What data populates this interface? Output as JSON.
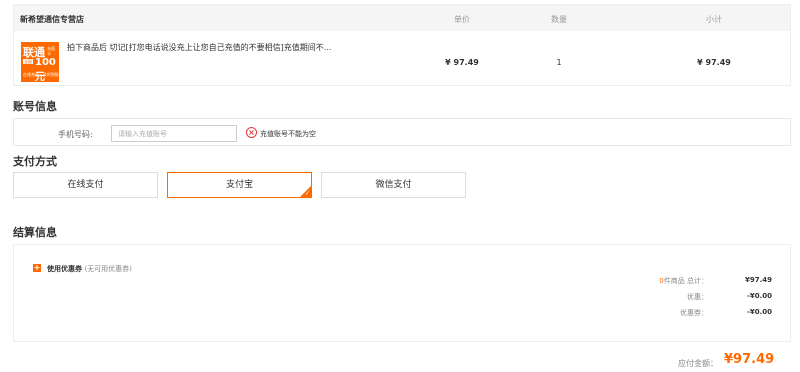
{
  "order": {
    "store_name": "新希望通信专营店",
    "headers": {
      "price": "单价",
      "quantity": "数量",
      "subtotal": "小计"
    },
    "product": {
      "thumb_text": {
        "brand": "联通",
        "tag": "充值卡",
        "sub": "全国",
        "amount": "100元",
        "footer": "在线充值 · 及时到账"
      },
      "title": "拍下商品后 切记[打您电话说没充上让您自己充值的不要相信]充值期间不...",
      "price": "¥ 97.49",
      "quantity": "1",
      "subtotal": "¥ 97.49"
    }
  },
  "account": {
    "section_title": "账号信息",
    "phone_label": "手机号码:",
    "phone_placeholder": "请输入充值账号",
    "phone_value": "",
    "error_text": "充值账号不能为空",
    "error_icon": "close-circle-icon"
  },
  "payment": {
    "section_title": "支付方式",
    "methods": [
      {
        "label": "在线支付",
        "selected": false
      },
      {
        "label": "支付宝",
        "selected": true
      },
      {
        "label": "微信支付",
        "selected": false
      }
    ]
  },
  "settlement": {
    "section_title": "结算信息",
    "coupon_label": "使用优惠券",
    "coupon_note": "(无可用优惠券)",
    "item_count": "0",
    "count_suffix": "件商品  总计：",
    "total_value": "¥97.49",
    "discount_label": "优惠：",
    "discount_value": "-¥0.00",
    "coupon_discount_label": "优惠券：",
    "coupon_discount_value": "-¥0.00"
  },
  "payable": {
    "label": "应付金额：",
    "value": "¥97.49"
  },
  "colors": {
    "accent": "#ff6a00",
    "error": "#e4393c",
    "header_bg": "#f5f5f5"
  }
}
